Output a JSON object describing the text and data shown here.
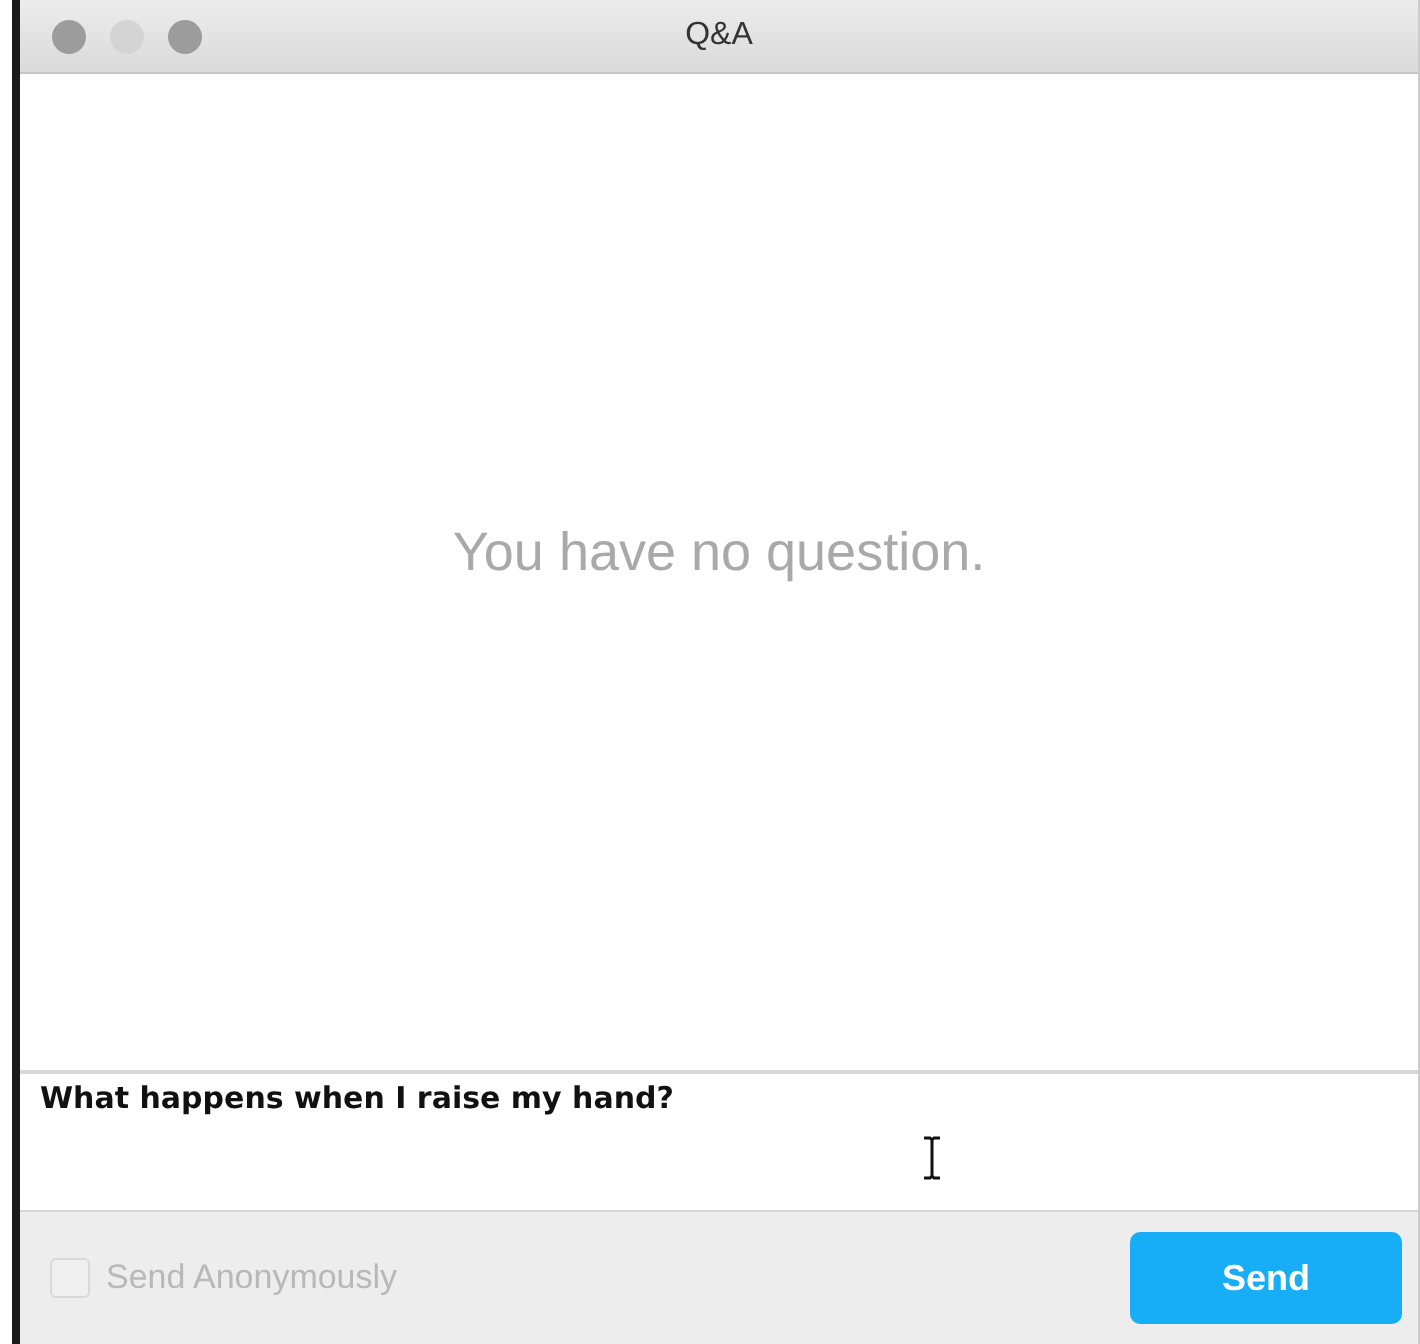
{
  "window": {
    "title": "Q&A"
  },
  "empty_message": "You have no question.",
  "question_input": {
    "value": "What happens when I raise my hand?"
  },
  "anonymous_option": {
    "label": "Send Anonymously",
    "checked": false,
    "disabled": true
  },
  "send_button": {
    "label": "Send"
  }
}
